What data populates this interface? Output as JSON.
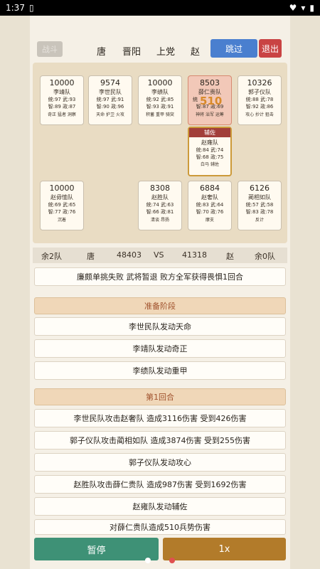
{
  "status": {
    "time": "1:37",
    "left_icon": "clipboard-icon",
    "right_icons": [
      "heart-icon",
      "wifi-icon",
      "battery-icon"
    ]
  },
  "topbar": {
    "battle_label": "战斗",
    "factions": [
      "唐",
      "晋阳",
      "上党",
      "赵"
    ],
    "skip_label": "跳过",
    "exit_label": "退出"
  },
  "cards": [
    {
      "troops": "10000",
      "name": "李靖队",
      "stat1": "统:97 武:93",
      "stat2": "智:89 政:87",
      "traits": "奇正 猛者 洞察"
    },
    {
      "troops": "9574",
      "name": "李世民队",
      "stat1": "统:97 武:91",
      "stat2": "智:90 政:96",
      "traits": "天命 护卫 火攻"
    },
    {
      "troops": "10000",
      "name": "李绩队",
      "stat1": "统:92 武:85",
      "stat2": "智:93 政:91",
      "traits": "积蓄 重甲 骑突"
    },
    {
      "troops": "8503",
      "name": "薛仁贵队",
      "stat1": "统",
      "stat2": "智:87 政:69",
      "traits": "神将 治军 运筹",
      "damage": "510"
    },
    {
      "troops": "10326",
      "name": "郭子仪队",
      "stat1": "统:88 武:78",
      "stat2": "智:92 政:86",
      "traits": "攻心 抄计 狙击"
    },
    {
      "troops": "10000",
      "name": "赵毋恤队",
      "stat1": "统:69 武:65",
      "stat2": "智:77 政:76",
      "traits": "沉着"
    },
    {
      "troops": "8308",
      "name": "赵胜队",
      "stat1": "统:74 武:63",
      "stat2": "智:66 政:81",
      "traits": "清谈 昂扬"
    },
    {
      "troops": "6884",
      "name": "赵奢队",
      "stat1": "统:83 武:64",
      "stat2": "智:70 政:76",
      "traits": "摩支"
    },
    {
      "troops": "6126",
      "name": "蔺相如队",
      "stat1": "统:57 武:58",
      "stat2": "智:83 政:78",
      "traits": "反计"
    }
  ],
  "support": {
    "header": "辅佐",
    "name": "赵雍队",
    "stat1": "统:84 武:74",
    "stat2": "智:68 政:75",
    "traits": "白马 辅佐"
  },
  "summary": {
    "left_remain": "余2队",
    "left_faction": "唐",
    "left_total": "48403",
    "vs": "VS",
    "right_total": "41318",
    "right_faction": "赵",
    "right_remain": "余0队"
  },
  "duel_result": "廉颇单挑失败 武将暂退 败方全军获得畏惧1回合",
  "phase_prep": "准备阶段",
  "prep_events": [
    "李世民队发动天命",
    "李靖队发动奇正",
    "李绩队发动重甲"
  ],
  "phase_round1": "第1回合",
  "round1_events": [
    "李世民队攻击赵奢队 造成3116伤害 受到426伤害",
    "郭子仪队攻击蔺相如队 造成3874伤害 受到255伤害",
    "郭子仪队发动攻心",
    "赵胜队攻击薛仁贵队 造成987伤害 受到1692伤害",
    "赵雍队发动辅佐",
    "对薛仁贵队造成510兵势伤害"
  ],
  "controls": {
    "pause_label": "暂停",
    "speed_label": "1x"
  },
  "colors": {
    "skip": "#4a7fcf",
    "exit": "#c94343",
    "pause": "#3e9176",
    "speed": "#b27b2a",
    "highlight_card": "#f2c8b8"
  }
}
